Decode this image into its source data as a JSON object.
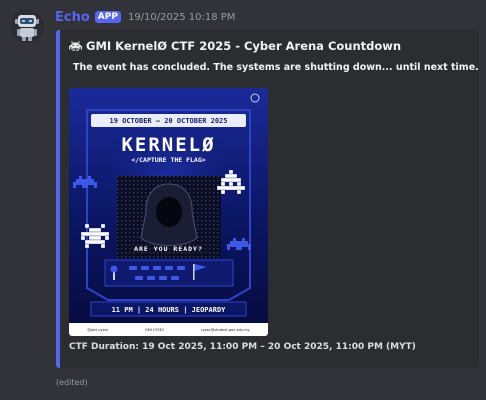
{
  "message": {
    "author": "Echo",
    "badge": "APP",
    "timestamp": "19/10/2025 10:18 PM",
    "edited_label": "(edited)"
  },
  "embed": {
    "accent_color": "#5865f2",
    "title_icon": "space-invader-icon",
    "title": "GMI KernelØ CTF 2025 - Cyber Arena Countdown",
    "description_icon": "checkered-flag-icon",
    "description": "The event has concluded. The systems are shutting down... until next time.",
    "footer": "CTF Duration: 19 Oct 2025, 11:00 PM – 20 Oct 2025, 11:00 PM (MYT)"
  },
  "poster": {
    "dates": "19 OCTOBER – 20 OCTOBER 2025",
    "title": "KERNELØ",
    "subtitle": "</CAPTURE THE FLAG>",
    "prompt": "ARE YOU READY?",
    "details": "11 PM | 24 HOURS | JEOPARDY",
    "contacts": [
      "@gmi.cysec",
      "GMI CYSEC",
      "cysec@student.gmi.edu.my"
    ]
  }
}
